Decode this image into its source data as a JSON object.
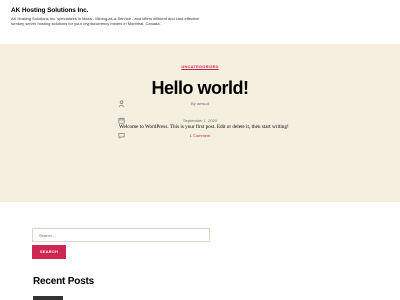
{
  "site": {
    "title": "AK Hosting Solutions Inc.",
    "description": "AK Hosting Solutions Inc. specializes in Mass - Mining-as-a-Service - and offers efficient and cost-effective turnkey server hosting solutions for your cryptocurrency miners in Montreal, Canada."
  },
  "post": {
    "category": "UNCATEGORIZED",
    "title": "Hello world!",
    "author": "By amsud",
    "date": "September 1, 2020",
    "comments": "1 Comment",
    "content": "Welcome to WordPress. This is your first post. Edit or delete it, then start writing!"
  },
  "search": {
    "placeholder": "Search ...",
    "button_label": "SEARCH"
  },
  "recent_posts": {
    "title": "Recent Posts"
  },
  "colors": {
    "accent": "#cd2653",
    "hero_bg": "#f5efe0"
  },
  "icons": {
    "author": "person-icon",
    "date": "calendar-icon",
    "comments": "comment-icon"
  }
}
